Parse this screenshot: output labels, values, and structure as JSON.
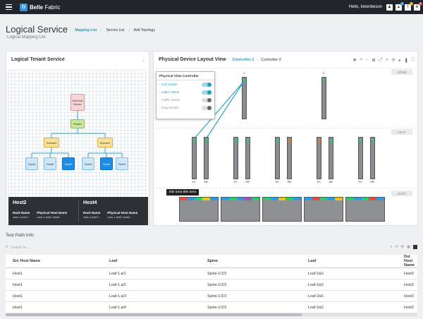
{
  "topbar": {
    "brand_prefix": "O",
    "brand_bold": "Belle",
    "brand_rest": " Fabric",
    "greeting": "Hello, kwonbeson",
    "icons": [
      "user-icon",
      "bell-icon",
      "alert-icon",
      "settings-icon"
    ],
    "badges": [
      "2",
      "0",
      "1"
    ]
  },
  "header": {
    "title": "Logical Service",
    "subtitle": "Logical Mapping List",
    "nav": [
      "Mapping List",
      "Service List",
      "Add Topology"
    ]
  },
  "tenant": {
    "title": "Logical Tenant Service",
    "nodes": {
      "ext": "External\nRouter",
      "router": "Router",
      "subnet0": "Subnet0",
      "subnet1": "Subnet1",
      "hosts": [
        "Host5",
        "Host2",
        "Host4",
        "Host3",
        "Host4",
        "Host1"
      ]
    },
    "info": [
      {
        "name": "Host2",
        "rack_label": "Rack Name",
        "rack": "rack-1-leaf-1",
        "phys_label": "Physical Host Name",
        "phys": "rack-1-leaf1-host0"
      },
      {
        "name": "Host4",
        "rack_label": "Rack Name",
        "rack": "rack-1-leaf-1",
        "phys_label": "Physical Host Name",
        "phys": "rack-1-leaf1-host0"
      }
    ]
  },
  "device": {
    "title": "Physical Device Layout View",
    "controllers": [
      "Controller-1",
      "Controller-2"
    ],
    "spine_label": "SPINE",
    "leaf_label": "LEAF",
    "host_label": "HOST",
    "spines": [
      "1",
      "2"
    ],
    "leafs": [
      "1A",
      "1B",
      "2A",
      "2B",
      "3A",
      "3B",
      "4A",
      "4B",
      "5A",
      "5B"
    ],
    "tooltip": "title area title area",
    "pvc": {
      "title": "Physical View Controller",
      "rows": [
        {
          "label": "- Link Visible",
          "on": true
        },
        {
          "label": "- Label Visible",
          "on": true
        },
        {
          "label": "- Traffic Visible",
          "on": false
        },
        {
          "label": "- Drag Enable",
          "on": false
        }
      ]
    }
  },
  "test_path": {
    "title": "Test Path Info",
    "search_placeholder": "Search to ...",
    "columns": [
      "Src Host Name",
      "Leaf",
      "Spine",
      "Leaf",
      "Dst Host Name"
    ],
    "rows": [
      [
        "Host1",
        "Leaf-1.a/1",
        "Spine-1/1/3",
        "Leaf-2a/1",
        "Host3"
      ],
      [
        "Host1",
        "Leaf-1.a/2",
        "Spine-1/1/3",
        "Leaf-2a/1",
        "Host3"
      ],
      [
        "Host1",
        "Leaf-1.a/3",
        "Spine-1/1/3",
        "Leaf-2a/1",
        "Host3"
      ],
      [
        "Host1",
        "Leaf-1.a/4",
        "Spine-1/1/3",
        "Leaf-2a/1",
        "Host3"
      ]
    ]
  },
  "colors": {
    "accent": "#1aa0c8",
    "topbar": "#22262c",
    "selected_host": "#1c8de6"
  }
}
